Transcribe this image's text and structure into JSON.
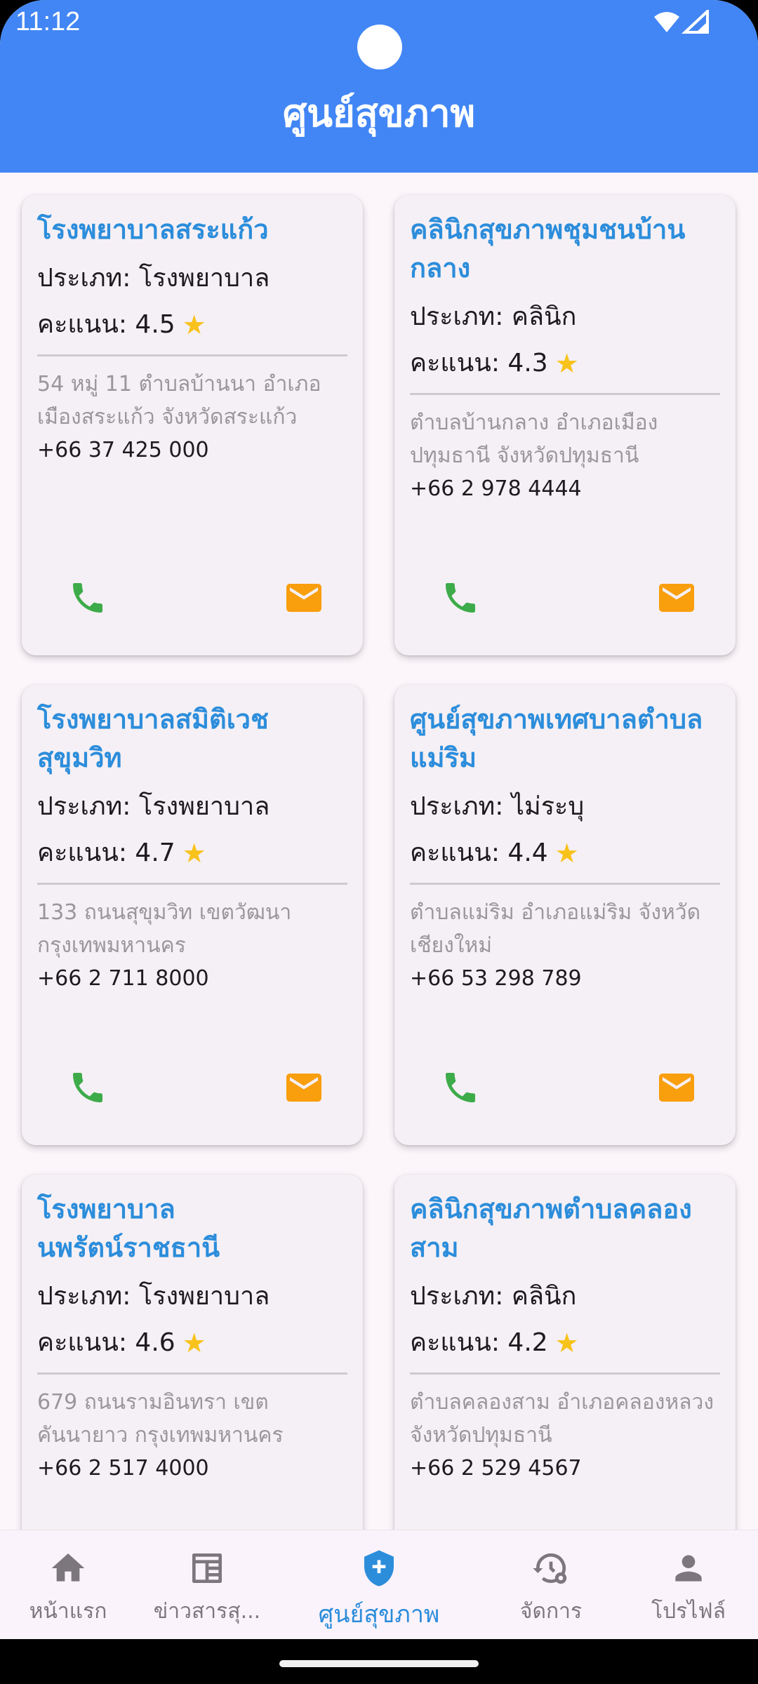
{
  "status": {
    "time": "11:12"
  },
  "app": {
    "title": "ศูนย์สุขภาพ"
  },
  "cards": [
    {
      "name": "โรงพยาบาลสระแก้ว",
      "type": "ประเภท: โรงพยาบาล",
      "rating": "คะแนน: 4.5",
      "address": "54 หมู่ 11 ตำบลบ้านนา อำเภอเมืองสระแก้ว จังหวัดสระแก้ว",
      "phone": "+66 37 425 000"
    },
    {
      "name": "คลินิกสุขภาพชุมชนบ้านกลาง",
      "type": "ประเภท: คลินิก",
      "rating": "คะแนน: 4.3",
      "address": "ตำบลบ้านกลาง อำเภอเมืองปทุมธานี จังหวัดปทุมธานี",
      "phone": "+66 2 978 4444"
    },
    {
      "name": "โรงพยาบาลสมิติเวชสุขุมวิท",
      "type": "ประเภท: โรงพยาบาล",
      "rating": "คะแนน: 4.7",
      "address": "133 ถนนสุขุมวิท เขตวัฒนา กรุงเทพมหานคร",
      "phone": "+66 2 711 8000"
    },
    {
      "name": "ศูนย์สุขภาพเทศบาลตำบลแม่ริม",
      "type": "ประเภท: ไม่ระบุ",
      "rating": "คะแนน: 4.4",
      "address": "ตำบลแม่ริม อำเภอแม่ริม จังหวัดเชียงใหม่",
      "phone": "+66 53 298 789"
    },
    {
      "name": "โรงพยาบาลนพรัตน์ราชธานี",
      "type": "ประเภท: โรงพยาบาล",
      "rating": "คะแนน: 4.6",
      "address": "679 ถนนรามอินทรา เขตคันนายาว กรุงเทพมหานคร",
      "phone": "+66 2 517 4000"
    },
    {
      "name": "คลินิกสุขภาพตำบลคลองสาม",
      "type": "ประเภท: คลินิก",
      "rating": "คะแนน: 4.2",
      "address": "ตำบลคลองสาม อำเภอคลองหลวง จังหวัดปทุมธานี",
      "phone": "+66 2 529 4567"
    }
  ],
  "nav": [
    {
      "label": "หน้าแรก",
      "icon": "home-icon",
      "active": false
    },
    {
      "label": "ข่าวสารสุ...",
      "icon": "newspaper-icon",
      "active": false
    },
    {
      "label": "ศูนย์สุขภาพ",
      "icon": "health-shield-icon",
      "active": true
    },
    {
      "label": "จัดการ",
      "icon": "manage-history-icon",
      "active": false
    },
    {
      "label": "โปรไฟล์",
      "icon": "person-icon",
      "active": false
    }
  ],
  "colors": {
    "primary": "#4286f5",
    "title_text": "#2c8ddb",
    "call_icon": "#3dab4a",
    "mail_icon": "#f99e0c",
    "star": "#f8c21c"
  }
}
